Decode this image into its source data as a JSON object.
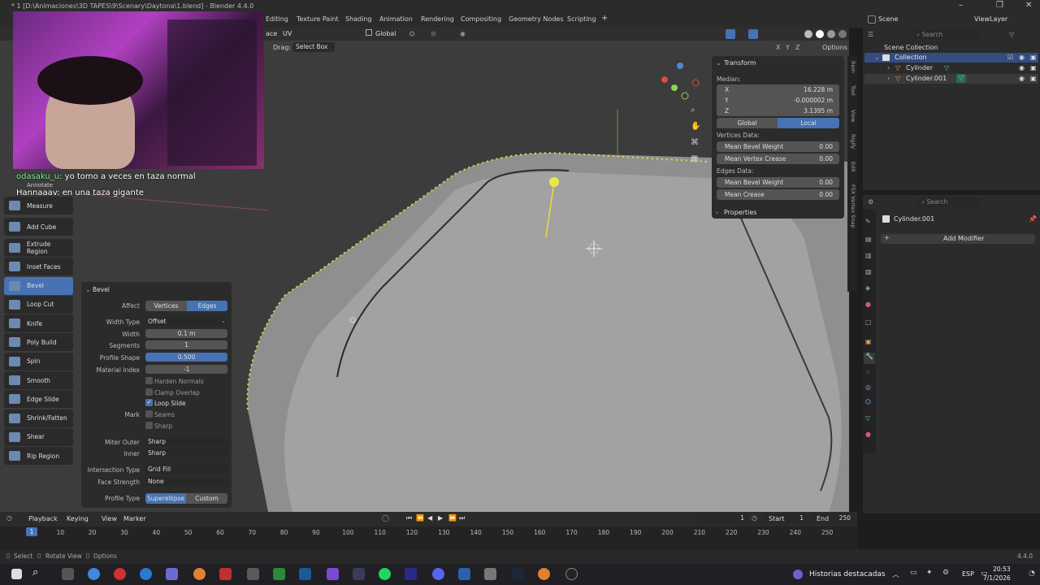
{
  "window": {
    "title": "* 1 [D:\\Animaciones\\3D TAPES\\9\\Scenary\\Daytona\\1.blend] - Blender 4.4.0"
  },
  "workspaces": [
    "Editing",
    "Texture Paint",
    "Shading",
    "Animation",
    "Rendering",
    "Compositing",
    "Geometry Nodes",
    "Scripting"
  ],
  "viewport_header": {
    "menu_frag": "ace",
    "uv": "UV",
    "orientation": "Global",
    "drag_label": "Drag:",
    "drag_value": "Select Box",
    "axes": [
      "X",
      "Y",
      "Z"
    ],
    "options": "Options"
  },
  "chat": [
    {
      "user": "odasaku_u:",
      "text": "yo tomo a veces en taza normal",
      "user_color": "#7cf0a0"
    },
    {
      "user": "Hannaaav:",
      "text": "en una taza gigante",
      "user_color": "#ffffff"
    }
  ],
  "toolbar": {
    "annotate": "Annotate",
    "items": [
      {
        "label": "Measure",
        "active": false
      },
      {
        "label": "Add Cube",
        "active": false
      },
      {
        "label": "Extrude Region",
        "active": false
      },
      {
        "label": "Inset Faces",
        "active": false
      },
      {
        "label": "Bevel",
        "active": true
      },
      {
        "label": "Loop Cut",
        "active": false
      },
      {
        "label": "Knife",
        "active": false
      },
      {
        "label": "Poly Build",
        "active": false
      },
      {
        "label": "Spin",
        "active": false
      },
      {
        "label": "Smooth",
        "active": false
      },
      {
        "label": "Edge Slide",
        "active": false
      },
      {
        "label": "Shrink/Fatten",
        "active": false
      },
      {
        "label": "Shear",
        "active": false
      },
      {
        "label": "Rip Region",
        "active": false
      }
    ]
  },
  "bevel": {
    "title": "Bevel",
    "affect_label": "Affect",
    "affect_vertices": "Vertices",
    "affect_edges": "Edges",
    "width_type_label": "Width Type",
    "width_type": "Offset",
    "width_label": "Width",
    "width": "0.1 m",
    "segments_label": "Segments",
    "segments": "1",
    "profile_shape_label": "Profile Shape",
    "profile_shape": "0.500",
    "material_index_label": "Material Index",
    "material_index": "-1",
    "harden_normals": "Harden Normals",
    "clamp_overlap": "Clamp Overlap",
    "loop_slide": "Loop Slide",
    "mark_label": "Mark",
    "seams": "Seams",
    "sharp": "Sharp",
    "miter_outer_label": "Miter Outer",
    "miter_outer": "Sharp",
    "inner_label": "Inner",
    "inner": "Sharp",
    "intersection_label": "Intersection Type",
    "intersection": "Grid Fill",
    "face_strength_label": "Face Strength",
    "face_strength": "None",
    "profile_type_label": "Profile Type",
    "profile_superellipse": "Superellipse",
    "profile_custom": "Custom"
  },
  "transform": {
    "title": "Transform",
    "median": "Median:",
    "x_label": "X",
    "x": "16.228 m",
    "y_label": "Y",
    "y": "-0.000002 m",
    "z_label": "Z",
    "z": "3.1395 m",
    "global": "Global",
    "local": "Local",
    "vertices_data": "Vertices Data:",
    "mean_bevel_weight": "Mean Bevel Weight",
    "v_bevel": "0.00",
    "mean_vertex_crease": "Mean Vertex Crease",
    "v_crease": "0.00",
    "edges_data": "Edges Data:",
    "e_bevel_label": "Mean Bevel Weight",
    "e_bevel": "0.00",
    "mean_crease": "Mean Crease",
    "e_crease": "0.00",
    "properties": "Properties"
  },
  "n_tabs": [
    "Item",
    "Tool",
    "View",
    "Rigify",
    "Edit",
    "FSX Vertex Snap"
  ],
  "top_right": {
    "scene": "Scene",
    "view_layer": "ViewLayer"
  },
  "outliner": {
    "search": "Search",
    "scene_collection": "Scene Collection",
    "collection": "Collection",
    "items": [
      "Cylinder",
      "Cylinder.001"
    ]
  },
  "properties_panel": {
    "search": "Search",
    "object": "Cylinder.001",
    "add_modifier": "Add Modifier"
  },
  "timeline": {
    "menus": [
      "Playback",
      "Keying",
      "View",
      "Marker"
    ],
    "current_frame": "1",
    "start_label": "Start",
    "start": "1",
    "end_label": "End",
    "end": "250",
    "ticks": [
      "1",
      "10",
      "20",
      "30",
      "40",
      "50",
      "60",
      "70",
      "80",
      "90",
      "100",
      "110",
      "120",
      "130",
      "140",
      "150",
      "160",
      "170",
      "180",
      "190",
      "200",
      "210",
      "220",
      "230",
      "240",
      "250"
    ]
  },
  "status": {
    "select": "Select",
    "rotate": "Rotate View",
    "options": "Options",
    "version": "4.4.0"
  },
  "taskbar": {
    "news": "Historias destacadas",
    "lang": "ESP",
    "time": "20:53",
    "date": "7/1/2026"
  }
}
